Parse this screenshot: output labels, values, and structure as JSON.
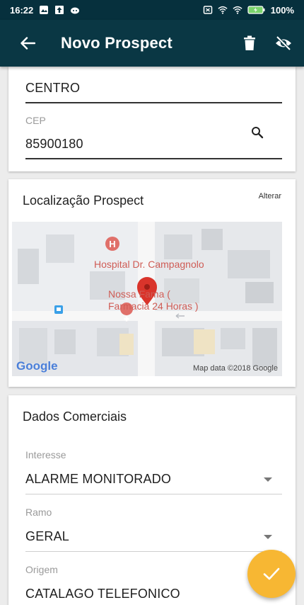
{
  "status_bar": {
    "time": "16:22",
    "battery": "100%"
  },
  "app_bar": {
    "title": "Novo Prospect",
    "back_icon": "arrow-back-icon",
    "delete_icon": "trash-icon",
    "hide_icon": "eye-off-icon"
  },
  "address_card": {
    "bairro_value": "CENTRO",
    "cep_label": "CEP",
    "cep_value": "85900180",
    "search_icon": "search-icon"
  },
  "location_card": {
    "title": "Localização Prospect",
    "change_label": "Alterar",
    "map": {
      "place_label": "Hospital Dr. Campagnolo",
      "poi_label_line1": "Nossa Fama (",
      "poi_label_line2": "Farmacia 24 Horas )",
      "brand": "Google",
      "attribution": "Map data ©2018 Google"
    }
  },
  "commercial_card": {
    "title": "Dados Comerciais",
    "interesse_label": "Interesse",
    "interesse_value": "ALARME MONITORADO",
    "ramo_label": "Ramo",
    "ramo_value": "GERAL",
    "origem_label": "Origem",
    "origem_value": "CATALAGO TELEFONICO"
  },
  "fab": {
    "icon": "check-icon"
  },
  "colors": {
    "app_bar": "#0a3744",
    "status_bar": "#06303d",
    "fab": "#f7b733",
    "map_pin": "#d9342b"
  }
}
